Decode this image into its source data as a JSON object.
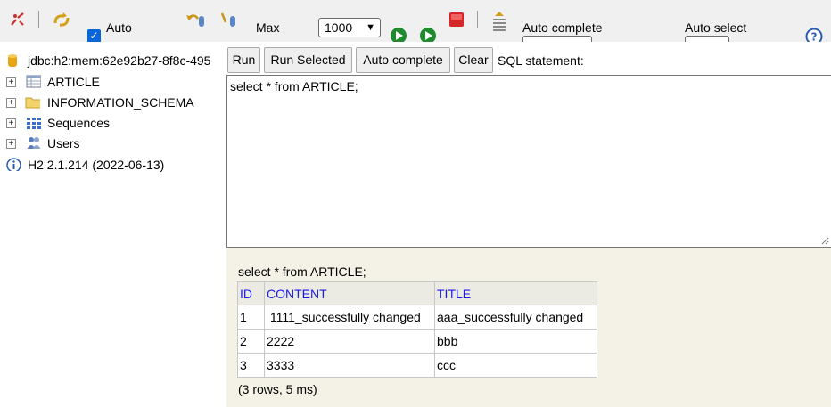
{
  "toolbar": {
    "auto_commit_label": "Auto",
    "auto_commit_checked": true,
    "max_rows_label": "Max",
    "max_rows_value": "1000",
    "auto_complete_label": "Auto complete",
    "auto_select_label": "Auto select",
    "icons": [
      "disconnect-icon",
      "refresh-icon",
      "rollback-icon",
      "commit-icon",
      "run-icon",
      "run-selected-icon",
      "stop-icon",
      "history-icon",
      "help-icon"
    ]
  },
  "tree": {
    "connection": "jdbc:h2:mem:62e92b27-8f8c-495",
    "items": [
      {
        "label": "ARTICLE",
        "icon": "table-icon"
      },
      {
        "label": "INFORMATION_SCHEMA",
        "icon": "folder-icon"
      },
      {
        "label": "Sequences",
        "icon": "sequences-icon"
      },
      {
        "label": "Users",
        "icon": "users-icon"
      }
    ],
    "version": "H2 2.1.214 (2022-06-13)"
  },
  "buttons": {
    "run": "Run",
    "run_selected": "Run Selected",
    "auto_complete": "Auto complete",
    "clear": "Clear"
  },
  "sql_statement_label": "SQL statement:",
  "editor_text": "select * from ARTICLE;",
  "results": {
    "query": "select * from ARTICLE;",
    "columns": [
      "ID",
      "CONTENT",
      "TITLE"
    ],
    "rows": [
      [
        "1",
        " 1111_successfully changed",
        "aaa_successfully changed"
      ],
      [
        "2",
        "2222",
        "bbb"
      ],
      [
        "3",
        "3333",
        "ccc"
      ]
    ],
    "footer": "(3 rows, 5 ms)"
  },
  "colors": {
    "toolbar_bg": "#f0f0f0",
    "results_bg": "#f4f2e6",
    "header_link": "#1a1ae6"
  }
}
